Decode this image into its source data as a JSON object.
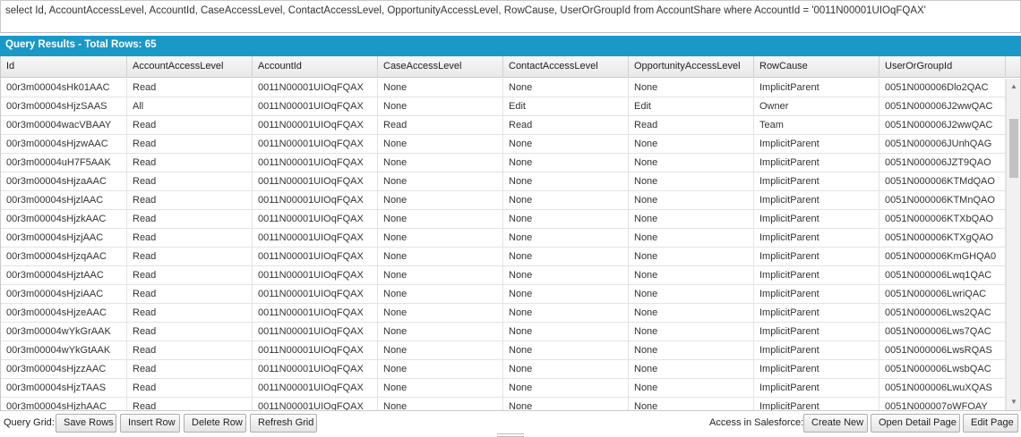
{
  "query": {
    "text": "select Id, AccountAccessLevel, AccountId, CaseAccessLevel, ContactAccessLevel, OpportunityAccessLevel, RowCause, UserOrGroupId from AccountShare where AccountId = '0011N00001UIOqFQAX'"
  },
  "results": {
    "title": "Query Results - Total Rows: 65"
  },
  "grid": {
    "columns": [
      "Id",
      "AccountAccessLevel",
      "AccountId",
      "CaseAccessLevel",
      "ContactAccessLevel",
      "OpportunityAccessLevel",
      "RowCause",
      "UserOrGroupId"
    ],
    "rows": [
      [
        "00r3m00004sHk01AAC",
        "Read",
        "0011N00001UIOqFQAX",
        "None",
        "None",
        "None",
        "ImplicitParent",
        "0051N000006Dlo2QAC"
      ],
      [
        "00r3m00004sHjzSAAS",
        "All",
        "0011N00001UIOqFQAX",
        "None",
        "Edit",
        "Edit",
        "Owner",
        "0051N000006J2wwQAC"
      ],
      [
        "00r3m00004wacVBAAY",
        "Read",
        "0011N00001UIOqFQAX",
        "Read",
        "Read",
        "Read",
        "Team",
        "0051N000006J2wwQAC"
      ],
      [
        "00r3m00004sHjzwAAC",
        "Read",
        "0011N00001UIOqFQAX",
        "None",
        "None",
        "None",
        "ImplicitParent",
        "0051N000006JUnhQAG"
      ],
      [
        "00r3m00004uH7F5AAK",
        "Read",
        "0011N00001UIOqFQAX",
        "None",
        "None",
        "None",
        "ImplicitParent",
        "0051N000006JZT9QAO"
      ],
      [
        "00r3m00004sHjzaAAC",
        "Read",
        "0011N00001UIOqFQAX",
        "None",
        "None",
        "None",
        "ImplicitParent",
        "0051N000006KTMdQAO"
      ],
      [
        "00r3m00004sHjzlAAC",
        "Read",
        "0011N00001UIOqFQAX",
        "None",
        "None",
        "None",
        "ImplicitParent",
        "0051N000006KTMnQAO"
      ],
      [
        "00r3m00004sHjzkAAC",
        "Read",
        "0011N00001UIOqFQAX",
        "None",
        "None",
        "None",
        "ImplicitParent",
        "0051N000006KTXbQAO"
      ],
      [
        "00r3m00004sHjzjAAC",
        "Read",
        "0011N00001UIOqFQAX",
        "None",
        "None",
        "None",
        "ImplicitParent",
        "0051N000006KTXgQAO"
      ],
      [
        "00r3m00004sHjzqAAC",
        "Read",
        "0011N00001UIOqFQAX",
        "None",
        "None",
        "None",
        "ImplicitParent",
        "0051N000006KmGHQA0"
      ],
      [
        "00r3m00004sHjztAAC",
        "Read",
        "0011N00001UIOqFQAX",
        "None",
        "None",
        "None",
        "ImplicitParent",
        "0051N000006Lwq1QAC"
      ],
      [
        "00r3m00004sHjziAAC",
        "Read",
        "0011N00001UIOqFQAX",
        "None",
        "None",
        "None",
        "ImplicitParent",
        "0051N000006LwriQAC"
      ],
      [
        "00r3m00004sHjzeAAC",
        "Read",
        "0011N00001UIOqFQAX",
        "None",
        "None",
        "None",
        "ImplicitParent",
        "0051N000006Lws2QAC"
      ],
      [
        "00r3m00004wYkGrAAK",
        "Read",
        "0011N00001UIOqFQAX",
        "None",
        "None",
        "None",
        "ImplicitParent",
        "0051N000006Lws7QAC"
      ],
      [
        "00r3m00004wYkGtAAK",
        "Read",
        "0011N00001UIOqFQAX",
        "None",
        "None",
        "None",
        "ImplicitParent",
        "0051N000006LwsRQAS"
      ],
      [
        "00r3m00004sHjzzAAC",
        "Read",
        "0011N00001UIOqFQAX",
        "None",
        "None",
        "None",
        "ImplicitParent",
        "0051N000006LwsbQAC"
      ],
      [
        "00r3m00004sHjzTAAS",
        "Read",
        "0011N00001UIOqFQAX",
        "None",
        "None",
        "None",
        "ImplicitParent",
        "0051N000006LwuXQAS"
      ],
      [
        "00r3m00004sHjzhAAC",
        "Read",
        "0011N00001UIOqFQAX",
        "None",
        "None",
        "None",
        "ImplicitParent",
        "0051N000007oWFOAY"
      ]
    ]
  },
  "toolbar": {
    "query_grid_label": "Query Grid:",
    "save_rows": "Save Rows",
    "insert_row": "Insert Row",
    "delete_row": "Delete Row",
    "refresh_grid": "Refresh Grid",
    "access_label": "Access in Salesforce:",
    "create_new": "Create New",
    "open_detail_page": "Open Detail Page",
    "edit_page": "Edit Page"
  },
  "colors": {
    "results_bar": "#1a98c6"
  },
  "icons": {
    "scroll_up": "triangle-up-icon",
    "scroll_down": "triangle-down-icon"
  }
}
